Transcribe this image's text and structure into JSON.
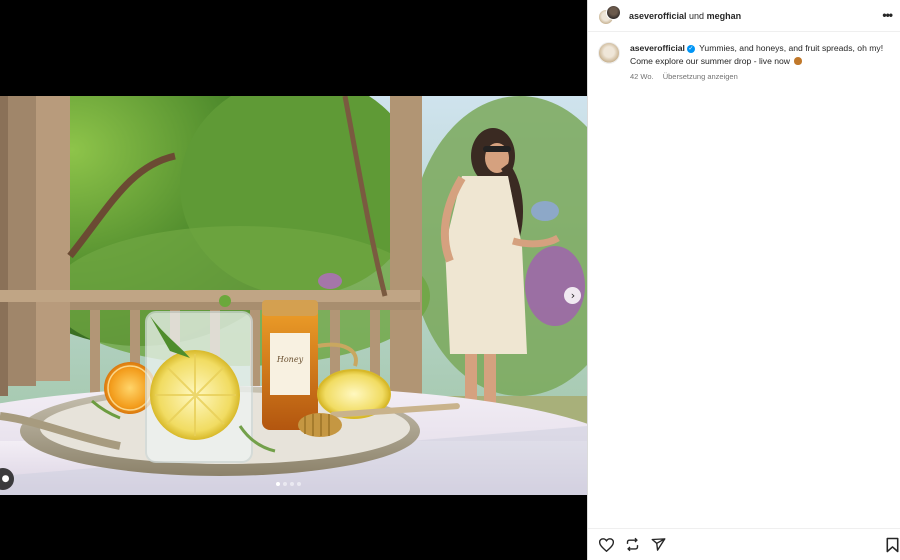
{
  "post": {
    "header": {
      "user1": "aseverofficial",
      "joiner": " und ",
      "user2": "meghan"
    },
    "caption": {
      "username": "aseverofficial",
      "verified_mark": "✓",
      "text": "Yummies, and honeys, and fruit spreads, oh my! Come explore our summer drop - live now",
      "emoji_icon": "honey-pot-icon",
      "age": "42 Wo.",
      "translate_label": "Übersetzung anzeigen"
    },
    "media": {
      "carousel_total": 4,
      "carousel_active": 1,
      "next_glyph": "›"
    },
    "icons": {
      "more": "more-options-icon",
      "like": "heart-icon",
      "share": "repost-icon",
      "send": "send-icon",
      "save": "bookmark-icon",
      "tag": "user-tag-icon"
    },
    "colors": {
      "verified": "#0095f6",
      "text": "#262626",
      "muted": "#737373"
    }
  }
}
